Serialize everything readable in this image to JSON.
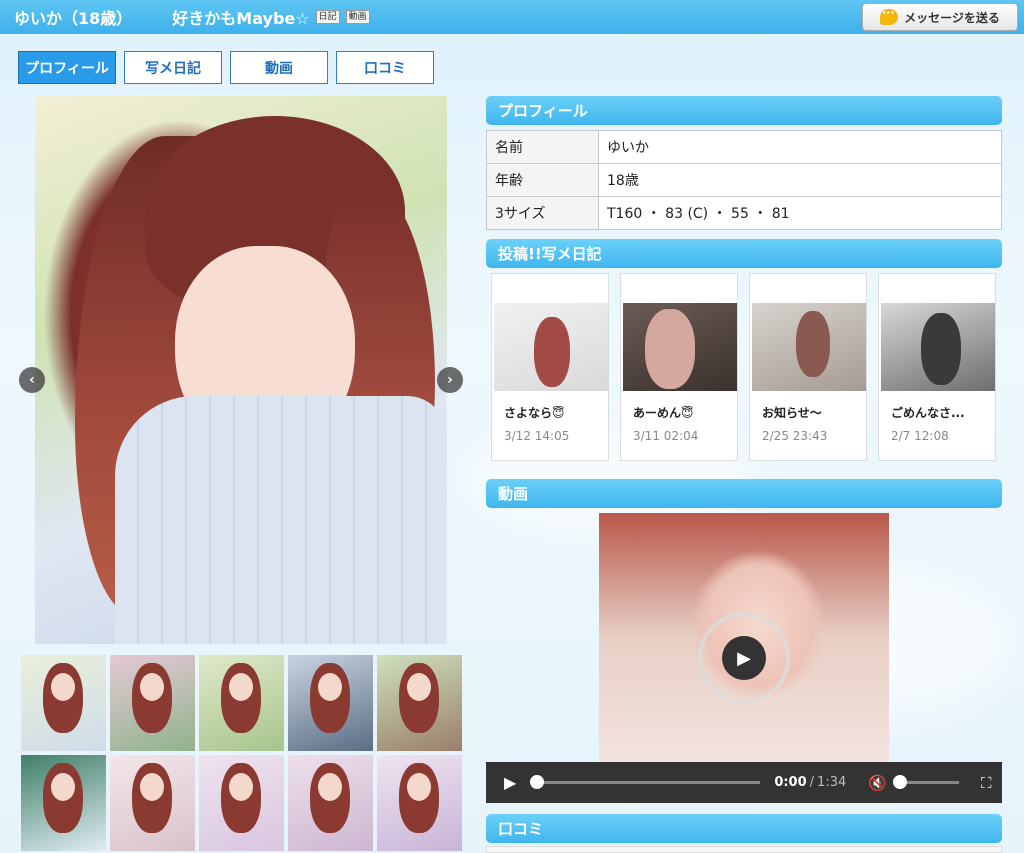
{
  "header": {
    "name": "ゆいか（18歳）",
    "catchphrase": "好きかもMaybe☆",
    "badges": [
      "日記",
      "動画"
    ],
    "message_button": "メッセージを送る"
  },
  "tabs": [
    "プロフィール",
    "写メ日記",
    "動画",
    "口コミ"
  ],
  "gallery": {
    "prev_arrow": "‹",
    "next_arrow": "›"
  },
  "profile": {
    "heading": "プロフィール",
    "rows": [
      {
        "label": "名前",
        "value": "ゆいか"
      },
      {
        "label": "年齢",
        "value": "18歳"
      },
      {
        "label": "3サイズ",
        "value": "T160 ・ 83 (C) ・ 55 ・ 81"
      }
    ]
  },
  "diary": {
    "heading": "投稿!!写メ日記",
    "entries": [
      {
        "title": "さよなら😇",
        "date": "3/12 14:05"
      },
      {
        "title": "あーめん😇",
        "date": "3/11 02:04"
      },
      {
        "title": "お知らせ〜",
        "date": "2/25 23:43"
      },
      {
        "title": "ごめんなさ...",
        "date": "2/7 12:08"
      }
    ]
  },
  "video": {
    "heading": "動画",
    "current_time": "0:00",
    "separator": "/",
    "duration": "1:34",
    "play_icon": "play-icon",
    "mute_icon": "mute-icon",
    "fullscreen_icon": "fullscreen-icon"
  },
  "reviews": {
    "heading": "口コミ"
  },
  "colors": {
    "accent": "#3fb6ee",
    "tab_active": "#2a9be8"
  }
}
